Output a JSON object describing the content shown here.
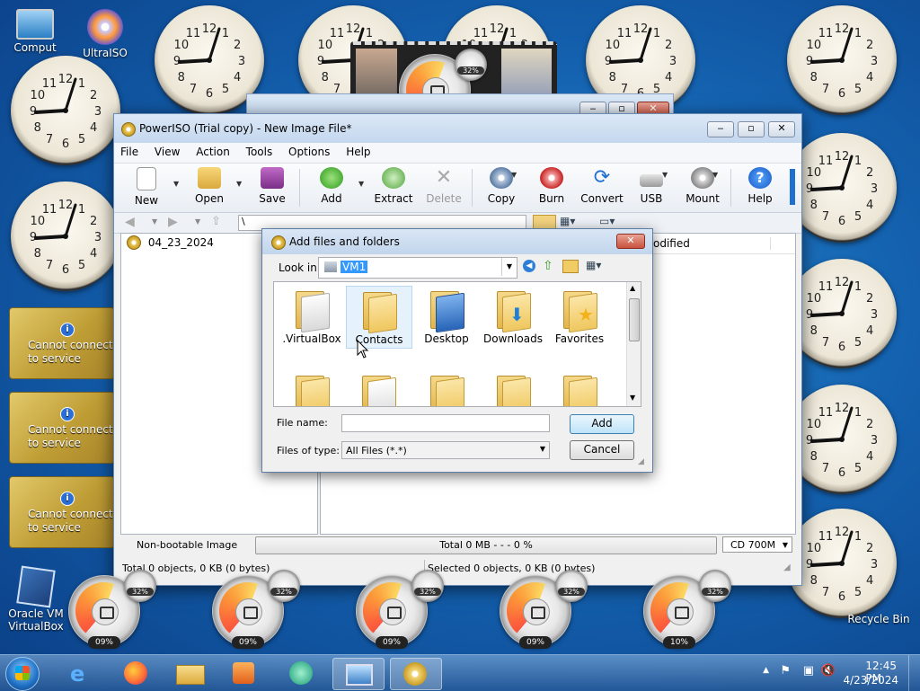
{
  "desktop": {
    "icons": [
      {
        "label": "Comput",
        "icon": "computer-icon"
      },
      {
        "label": "UltraISO",
        "icon": "ultraiso-icon"
      },
      {
        "label": "Oracle VM VirtualBox",
        "icon": "virtualbox-icon"
      },
      {
        "label": "Recycle Bin",
        "icon": "recycle-bin-icon"
      }
    ],
    "gadgets": [
      {
        "line1": "Cannot connect",
        "line2": "to service"
      },
      {
        "line1": "Cannot connect",
        "line2": "to service"
      },
      {
        "line1": "Cannot connect",
        "line2": "to service"
      }
    ],
    "gauges": [
      {
        "cpu": "09%",
        "mem": "32%"
      },
      {
        "cpu": "09%",
        "mem": "32%"
      },
      {
        "cpu": "09%",
        "mem": "32%"
      },
      {
        "cpu": "09%",
        "mem": "32%"
      },
      {
        "cpu": "10%",
        "mem": "32%"
      }
    ],
    "top_gauge_mem": "32%"
  },
  "window": {
    "title": "PowerISO (Trial copy) - New Image File*",
    "menu": [
      "File",
      "View",
      "Action",
      "Tools",
      "Options",
      "Help"
    ],
    "toolbar": [
      {
        "label": "New",
        "icon": "new-icon",
        "enabled": true
      },
      {
        "label": "Open",
        "icon": "open-icon",
        "enabled": true
      },
      {
        "label": "Save",
        "icon": "save-icon",
        "enabled": true
      },
      {
        "label": "Add",
        "icon": "add-icon",
        "enabled": true
      },
      {
        "label": "Extract",
        "icon": "extract-icon",
        "enabled": true
      },
      {
        "label": "Delete",
        "icon": "delete-icon",
        "enabled": false
      },
      {
        "label": "Copy",
        "icon": "copy-icon",
        "enabled": true
      },
      {
        "label": "Burn",
        "icon": "burn-icon",
        "enabled": true
      },
      {
        "label": "Convert",
        "icon": "convert-icon",
        "enabled": true
      },
      {
        "label": "USB",
        "icon": "usb-icon",
        "enabled": true
      },
      {
        "label": "Mount",
        "icon": "mount-icon",
        "enabled": true
      },
      {
        "label": "Help",
        "icon": "help-icon",
        "enabled": true
      }
    ],
    "address": "\\",
    "tree_root": "04_23_2024",
    "column_header_partial": "odified",
    "status": {
      "boot": "Non-bootable Image",
      "total": "Total  0 MB   - - -  0 %",
      "media": "CD 700M",
      "total_objects": "Total 0 objects, 0 KB (0 bytes)",
      "selected_objects": "Selected 0 objects, 0 KB (0 bytes)"
    }
  },
  "dialog": {
    "title": "Add files and folders",
    "look_in_label": "Look in:",
    "look_in_value": "VM1",
    "folders": [
      {
        "label": ".VirtualBox",
        "icon": "folder-icon"
      },
      {
        "label": "Contacts",
        "icon": "contacts-folder-icon"
      },
      {
        "label": "Desktop",
        "icon": "desktop-folder-icon"
      },
      {
        "label": "Downloads",
        "icon": "downloads-folder-icon"
      },
      {
        "label": "Favorites",
        "icon": "favorites-folder-icon"
      }
    ],
    "file_name_label": "File name:",
    "file_name_value": "",
    "files_of_type_label": "Files of type:",
    "files_of_type_value": "All Files (*.*)",
    "add_label": "Add",
    "cancel_label": "Cancel"
  },
  "taskbar": {
    "time": "12:45 PM",
    "date": "4/23/2024"
  },
  "colors": {
    "accent": "#3c7fb1",
    "close_red": "#c9513d",
    "desktop_blue": "#1462b0"
  }
}
